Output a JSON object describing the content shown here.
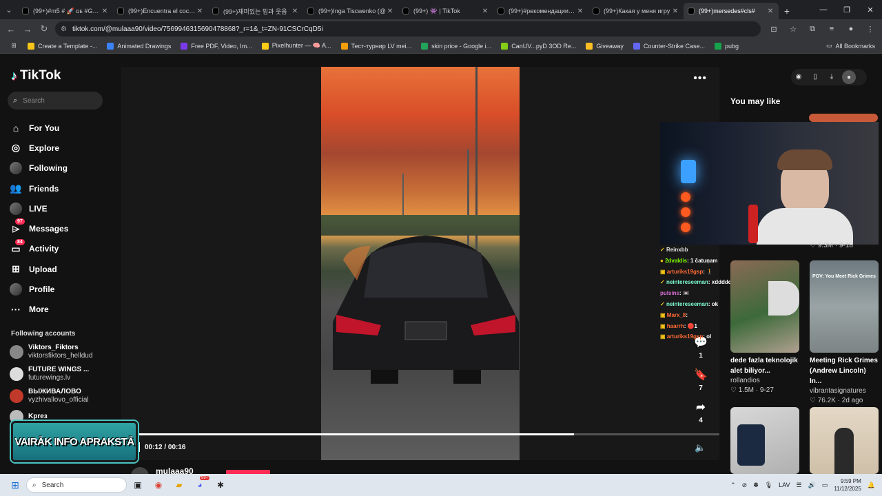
{
  "browser": {
    "tabs": [
      {
        "title": "(99+)#m5 # 🚀 ᴅᴇ #GTR #",
        "active": false
      },
      {
        "title": "(99+)Encuentra el coche",
        "active": false
      },
      {
        "title": "(99+)재미있는 밈과 웃음",
        "active": false
      },
      {
        "title": "(99+)Inga Tiscwenko (@",
        "active": false
      },
      {
        "title": "(99+) 👾 | TikTok",
        "active": false
      },
      {
        "title": "(99+)#рекомендации | T",
        "active": false
      },
      {
        "title": "(99+)Какая у меня игру",
        "active": false
      },
      {
        "title": "(99+)mersedes#cls#",
        "active": true
      }
    ],
    "url": "tiktok.com/@mulaaa90/video/7569946315690478868?_r=1&_t=ZN-91CSCrCqD5i",
    "bookmarks": [
      {
        "label": "Create a Template -...",
        "color": "#f5c518"
      },
      {
        "label": "Animated Drawings",
        "color": "#3b82f6"
      },
      {
        "label": "Free PDF, Video, Im...",
        "color": "#7c3aed"
      },
      {
        "label": "Pixelhunter — 🧠 A...",
        "color": "#facc15"
      },
      {
        "label": "Тест-турнир LV mei...",
        "color": "#f59e0b"
      },
      {
        "label": "skin price - Google i...",
        "color": "#22a55a"
      },
      {
        "label": "CanUV...pyD 3OD Re...",
        "color": "#84cc16"
      },
      {
        "label": "Giveaway",
        "color": "#fbbf24"
      },
      {
        "label": "Counter-Strike Case...",
        "color": "#6366f1"
      },
      {
        "label": "pubg",
        "color": "#16a34a"
      }
    ],
    "all_bookmarks": "All Bookmarks"
  },
  "sidebar": {
    "logo": "TikTok",
    "search_placeholder": "Search",
    "nav": [
      {
        "label": "For You",
        "icon": "home-icon",
        "glyph": "⌂"
      },
      {
        "label": "Explore",
        "icon": "compass-icon",
        "glyph": "◎"
      },
      {
        "label": "Following",
        "icon": "following-avatar-icon",
        "glyph": ""
      },
      {
        "label": "Friends",
        "icon": "friends-icon",
        "glyph": "👥"
      },
      {
        "label": "LIVE",
        "icon": "live-avatar-icon",
        "glyph": ""
      },
      {
        "label": "Messages",
        "icon": "messages-icon",
        "glyph": "⌲",
        "badge": "97"
      },
      {
        "label": "Activity",
        "icon": "activity-icon",
        "glyph": "▭",
        "badge": "84"
      },
      {
        "label": "Upload",
        "icon": "upload-icon",
        "glyph": "⊞"
      },
      {
        "label": "Profile",
        "icon": "profile-avatar-icon",
        "glyph": ""
      },
      {
        "label": "More",
        "icon": "more-icon",
        "glyph": "···"
      }
    ],
    "following_header": "Following accounts",
    "accounts": [
      {
        "name": "Viktors_Fiktors",
        "handle": "viktorsfiktors_helldud",
        "color": "#888"
      },
      {
        "name": "FUTURE WINGS ...",
        "handle": "futurewings.lv",
        "color": "#ddd"
      },
      {
        "name": "ВЫЖИВАЛОВО",
        "handle": "vyzhivallovo_official",
        "color": "#c0392b"
      },
      {
        "name": "Kpreз",
        "handle": "",
        "color": "#bbb"
      }
    ],
    "overlay_banner": "VAIRĀK INFO APRAKSTĀ"
  },
  "video": {
    "time": "00:12 / 00:16",
    "progress": 0.75,
    "actions": [
      {
        "icon": "comment-icon",
        "glyph": "💬",
        "count": "1"
      },
      {
        "icon": "bookmark-icon",
        "glyph": "🔖",
        "count": "7"
      },
      {
        "icon": "share-icon",
        "glyph": "➦",
        "count": "4"
      }
    ],
    "author": "mulaaa90"
  },
  "chat": [
    {
      "user": "Reinxbb",
      "msg": "",
      "color": "#e0e0e0",
      "prefix": "✓"
    },
    {
      "user": "2dvaldis",
      "msg": ": 1 čatuņam",
      "color": "#7fff00",
      "prefix": "●"
    },
    {
      "user": "arturiks19gsp",
      "msg": ": 🚶",
      "color": "#ff6b35",
      "prefix": "▣"
    },
    {
      "user": "neintereseeman",
      "msg": ": xdddddd",
      "color": "#7fffd4",
      "prefix": "✓"
    },
    {
      "user": "pulsins",
      "msg": ": 📼",
      "color": "#da70d6",
      "prefix": ""
    },
    {
      "user": "neintereseeman",
      "msg": ": ok",
      "color": "#7fffd4",
      "prefix": "✓"
    },
    {
      "user": "Marx_8",
      "msg": ":",
      "color": "#ff6b35",
      "prefix": "▣"
    },
    {
      "user": "haarrh",
      "msg": ": 🔴1",
      "color": "#ff6b35",
      "prefix": "▣"
    },
    {
      "user": "arturiks19gsp",
      "msg": ": ol",
      "color": "#ff6b35",
      "prefix": "▣"
    }
  ],
  "right_panel": {
    "title": "You may like",
    "cards": [
      {
        "title": "",
        "user": "",
        "stats": "",
        "partial": true,
        "stats_visible": "♡ 9.3M · 9-18"
      },
      {
        "title": "dede fazla teknolojik alet biliyor...",
        "user": "rollandios",
        "stats": "♡ 1.5M · 9-27"
      },
      {
        "title": "Meeting Rick Grimes (Andrew Lincoln) In...",
        "user": "vibrantasignatures",
        "stats": "♡ 76.2K · 2d ago",
        "thumb_text": "POV: You Meet Rick Grimes"
      }
    ]
  },
  "taskbar": {
    "search_placeholder": "Search",
    "lang": "LAV",
    "time": "9:59 PM",
    "date": "11/12/2025",
    "chat_badge": "99+"
  }
}
